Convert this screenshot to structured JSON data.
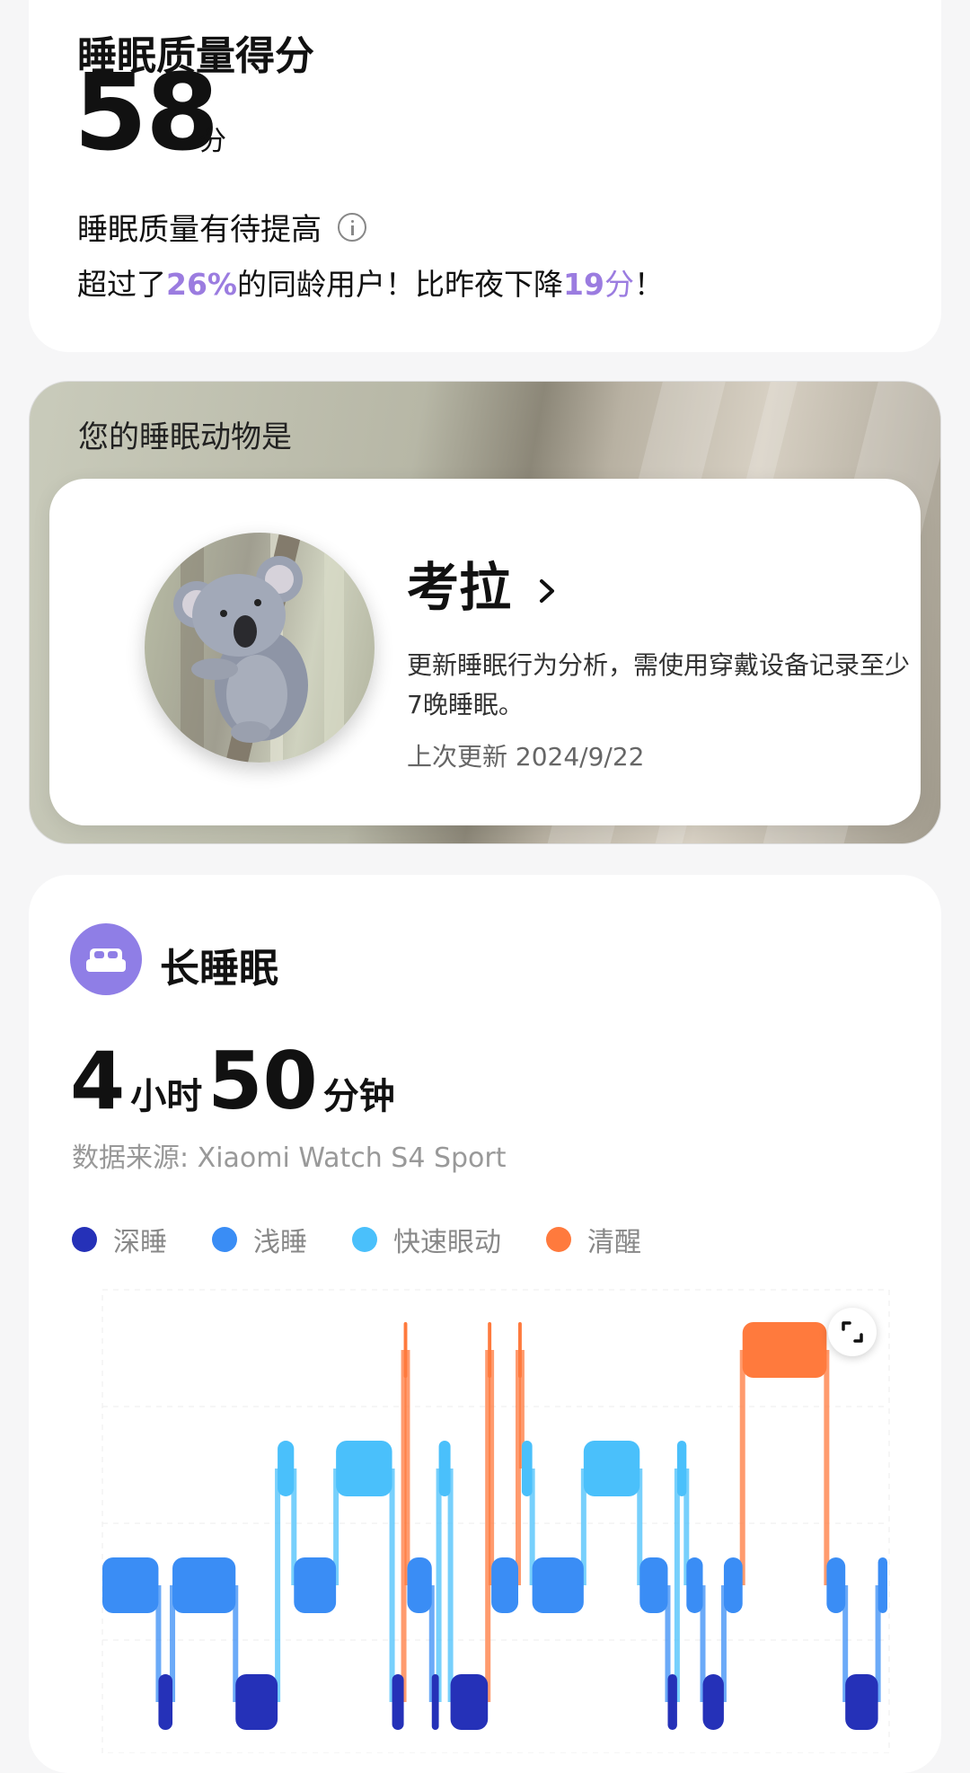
{
  "score": {
    "title": "睡眠质量得分",
    "value": "58",
    "unit": "分",
    "quality_text": "睡眠质量有待提高",
    "compare_prefix": "超过了",
    "percent": "26%",
    "compare_mid": "的同龄用户！比昨夜下降",
    "drop": "19",
    "drop_unit": "分",
    "compare_end": "！"
  },
  "animal": {
    "label": "您的睡眠动物是",
    "name": "考拉",
    "description": "更新睡眠行为分析，需使用穿戴设备记录至少7晚睡眠。",
    "updated": "上次更新 2024/9/22"
  },
  "sleep": {
    "title": "长睡眠",
    "hours": "4",
    "hours_unit": "小时",
    "minutes": "50",
    "minutes_unit": "分钟",
    "source": "数据来源: Xiaomi Watch S4 Sport",
    "legend": [
      {
        "label": "深睡",
        "color": "#2531b8"
      },
      {
        "label": "浅睡",
        "color": "#3a8df5"
      },
      {
        "label": "快速眼动",
        "color": "#4ac0fb"
      },
      {
        "label": "清醒",
        "color": "#ff7a3d"
      }
    ]
  },
  "chart_data": {
    "type": "area",
    "levels": [
      "清醒",
      "快速眼动",
      "浅睡",
      "深睡"
    ],
    "colors": {
      "清醒": "#ff7a3d",
      "快速眼动": "#4ac0fb",
      "浅睡": "#3a8df5",
      "深睡": "#2531b8"
    },
    "segments": [
      {
        "stage": "浅睡",
        "start": 0.0,
        "end": 2.4
      },
      {
        "stage": "深睡",
        "start": 2.4,
        "end": 3.0
      },
      {
        "stage": "浅睡",
        "start": 3.0,
        "end": 5.7
      },
      {
        "stage": "深睡",
        "start": 5.7,
        "end": 7.5
      },
      {
        "stage": "快速眼动",
        "start": 7.5,
        "end": 8.2
      },
      {
        "stage": "浅睡",
        "start": 8.2,
        "end": 10.0
      },
      {
        "stage": "快速眼动",
        "start": 10.0,
        "end": 12.4
      },
      {
        "stage": "深睡",
        "start": 12.4,
        "end": 12.9
      },
      {
        "stage": "清醒",
        "start": 12.9,
        "end": 13.05
      },
      {
        "stage": "浅睡",
        "start": 13.05,
        "end": 14.1
      },
      {
        "stage": "深睡",
        "start": 14.1,
        "end": 14.4
      },
      {
        "stage": "快速眼动",
        "start": 14.4,
        "end": 14.9
      },
      {
        "stage": "深睡",
        "start": 14.9,
        "end": 16.5
      },
      {
        "stage": "清醒",
        "start": 16.5,
        "end": 16.65
      },
      {
        "stage": "浅睡",
        "start": 16.65,
        "end": 17.8
      },
      {
        "stage": "清醒",
        "start": 17.8,
        "end": 17.95
      },
      {
        "stage": "快速眼动",
        "start": 17.95,
        "end": 18.4
      },
      {
        "stage": "浅睡",
        "start": 18.4,
        "end": 20.6
      },
      {
        "stage": "快速眼动",
        "start": 20.6,
        "end": 23.0
      },
      {
        "stage": "浅睡",
        "start": 23.0,
        "end": 24.2
      },
      {
        "stage": "深睡",
        "start": 24.2,
        "end": 24.6
      },
      {
        "stage": "快速眼动",
        "start": 24.6,
        "end": 25.0
      },
      {
        "stage": "浅睡",
        "start": 25.0,
        "end": 25.7
      },
      {
        "stage": "深睡",
        "start": 25.7,
        "end": 26.6
      },
      {
        "stage": "浅睡",
        "start": 26.6,
        "end": 27.4
      },
      {
        "stage": "清醒",
        "start": 27.4,
        "end": 31.0
      },
      {
        "stage": "浅睡",
        "start": 31.0,
        "end": 31.8
      },
      {
        "stage": "深睡",
        "start": 31.8,
        "end": 33.2
      },
      {
        "stage": "浅睡",
        "start": 33.2,
        "end": 33.6
      }
    ],
    "x_range": [
      0,
      33.6
    ]
  }
}
